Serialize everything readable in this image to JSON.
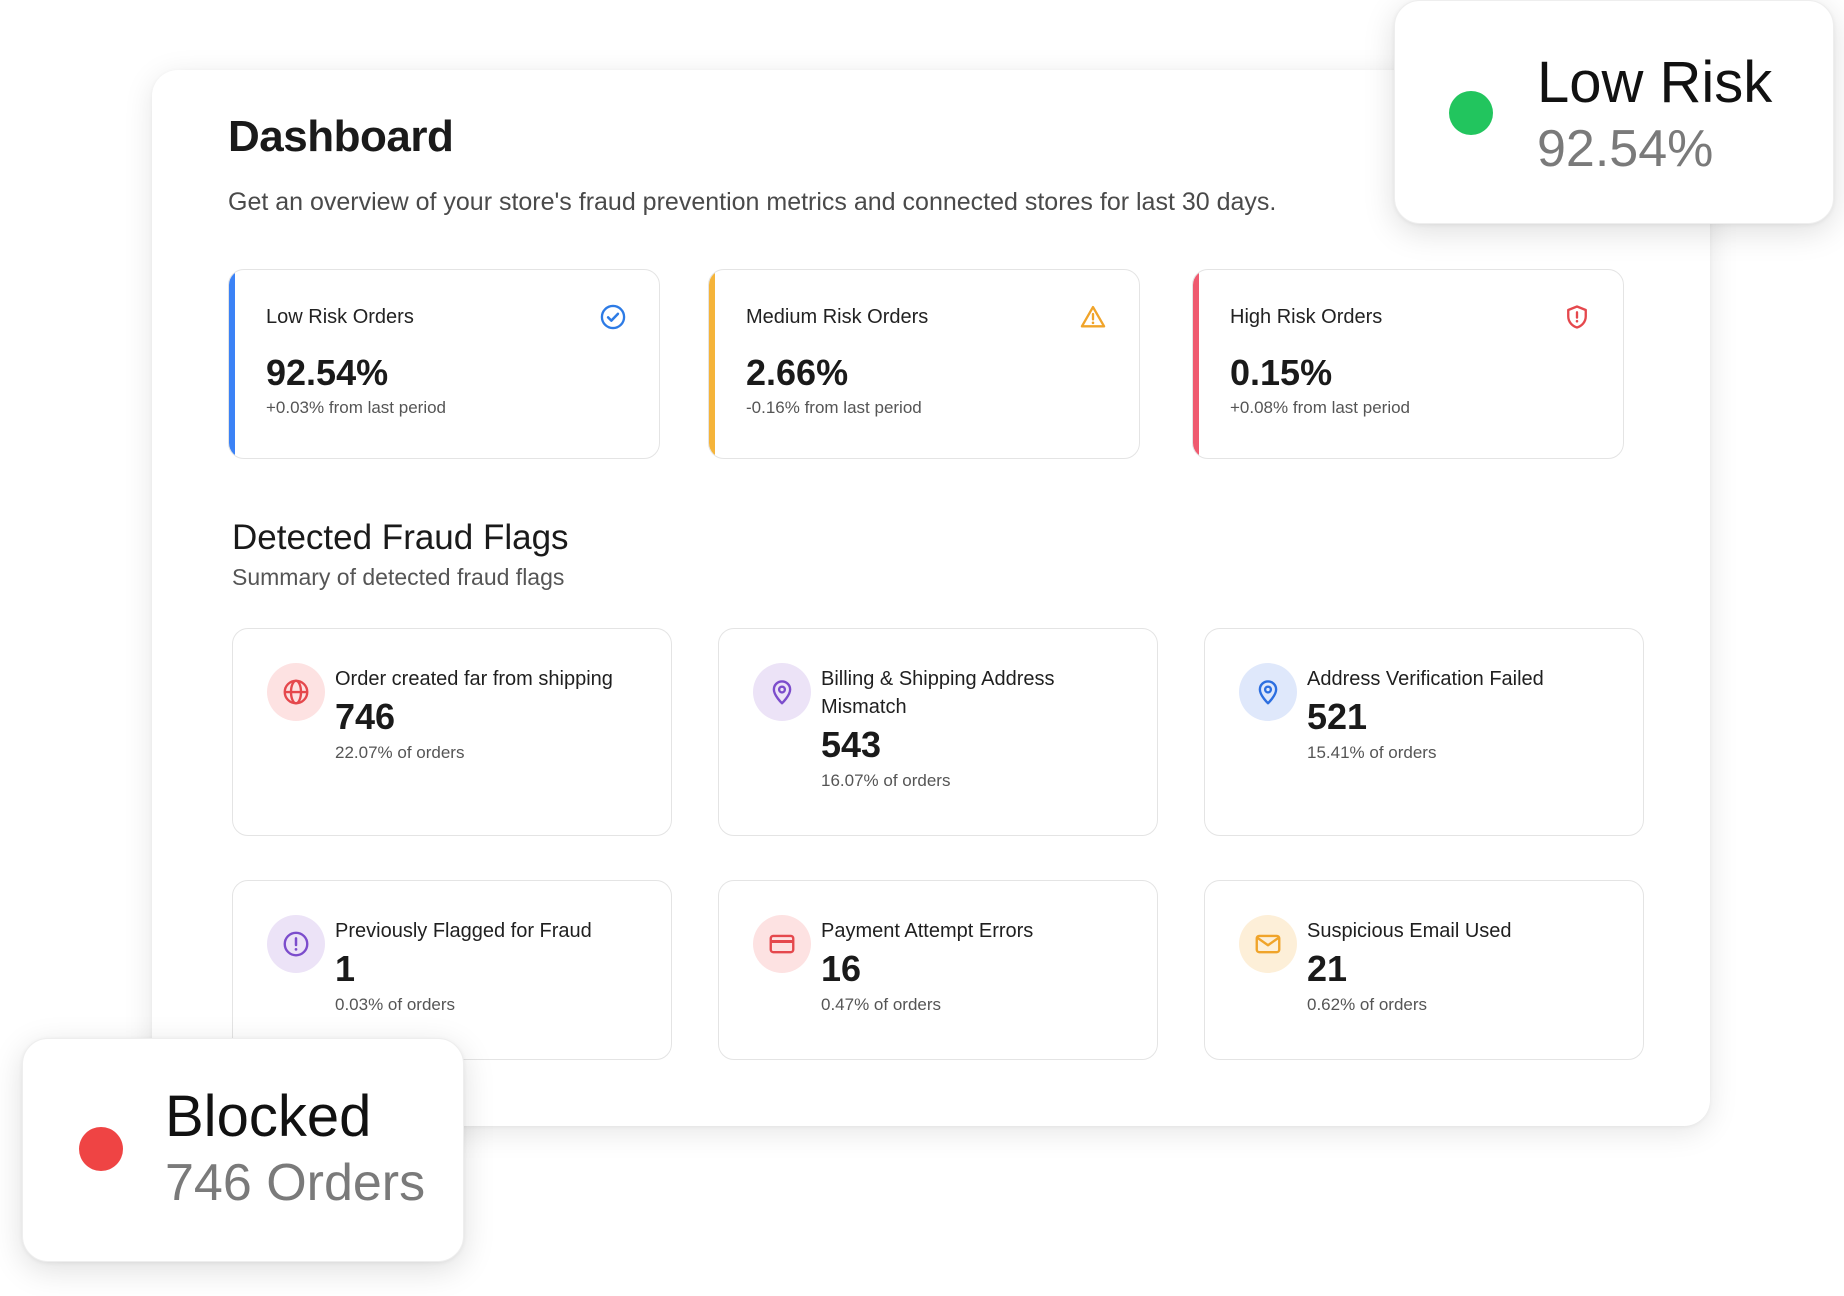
{
  "colors": {
    "blue": "#3b82f6",
    "amber": "#f5b43a",
    "red": "#ef5a6f",
    "green": "#22c55e",
    "blocked_red": "#ef4444"
  },
  "header": {
    "title": "Dashboard",
    "subtitle": "Get an overview of your store's fraud prevention metrics and connected stores for last 30 days."
  },
  "risk_cards": [
    {
      "label": "Low Risk Orders",
      "value": "92.54%",
      "change": "+0.03% from last period",
      "icon": "check-circle-icon",
      "color": "#3b82f6"
    },
    {
      "label": "Medium Risk Orders",
      "value": "2.66%",
      "change": "-0.16% from last period",
      "icon": "warning-triangle-icon",
      "color": "#f5b43a"
    },
    {
      "label": "High Risk Orders",
      "value": "0.15%",
      "change": "+0.08% from last period",
      "icon": "shield-alert-icon",
      "color": "#ef5a6f"
    }
  ],
  "fraud_flags": {
    "title": "Detected Fraud Flags",
    "subtitle": "Summary of detected fraud flags",
    "items": [
      {
        "title": "Order created far from shipping",
        "count": "746",
        "percent": "22.07% of orders",
        "icon": "globe-icon"
      },
      {
        "title": "Billing & Shipping Address Mismatch",
        "count": "543",
        "percent": "16.07% of orders",
        "icon": "map-pin-icon"
      },
      {
        "title": "Address Verification Failed",
        "count": "521",
        "percent": "15.41% of orders",
        "icon": "map-pin-icon"
      },
      {
        "title": "Previously Flagged for Fraud",
        "count": "1",
        "percent": "0.03% of orders",
        "icon": "alert-circle-icon"
      },
      {
        "title": "Payment Attempt Errors",
        "count": "16",
        "percent": "0.47% of orders",
        "icon": "credit-card-icon"
      },
      {
        "title": "Suspicious Email Used",
        "count": "21",
        "percent": "0.62% of orders",
        "icon": "mail-icon"
      }
    ]
  },
  "callouts": {
    "low_risk": {
      "title": "Low Risk",
      "value": "92.54%"
    },
    "blocked": {
      "title": "Blocked",
      "value": "746 Orders"
    }
  }
}
